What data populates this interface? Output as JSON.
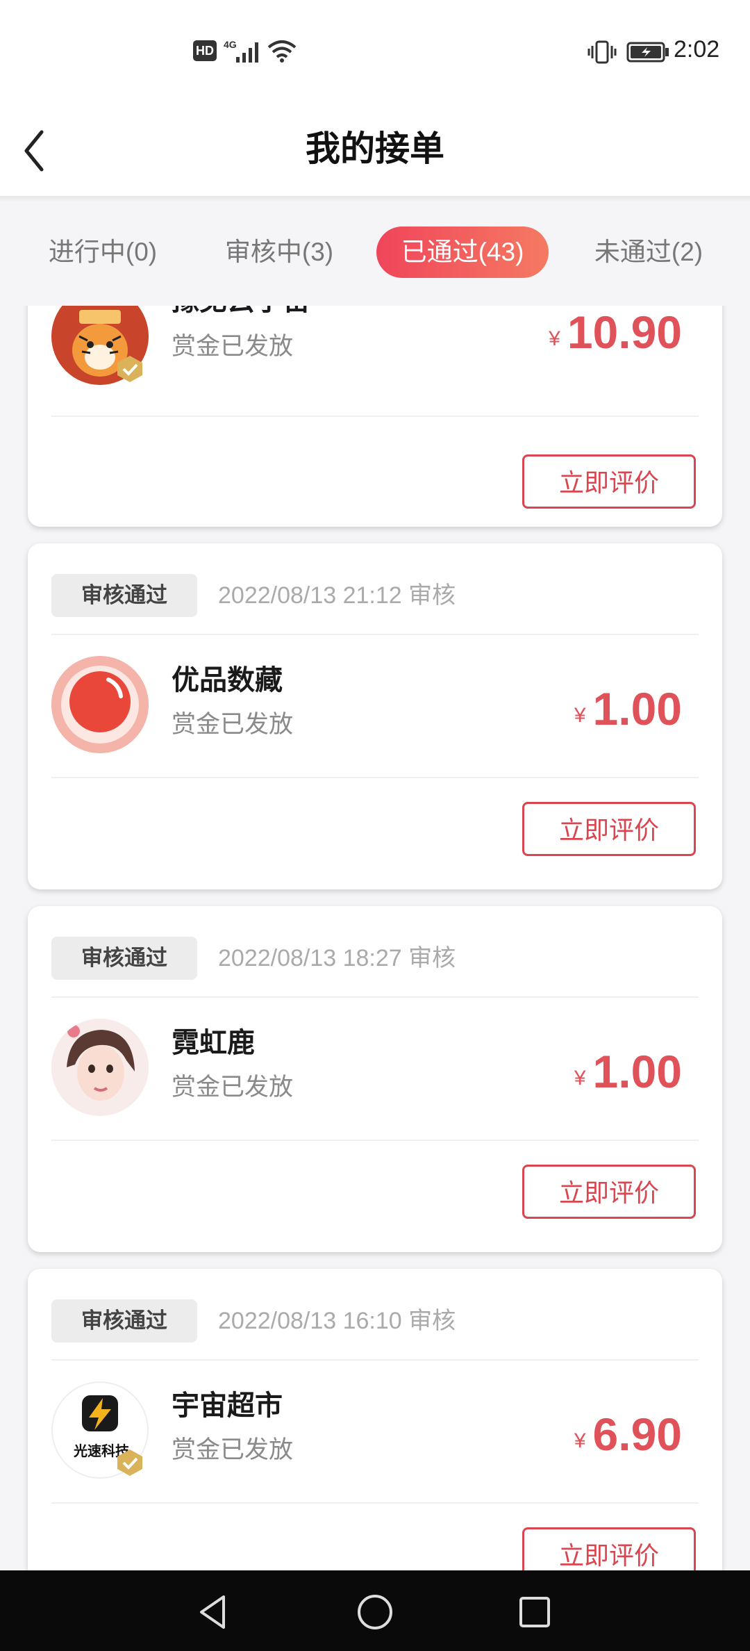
{
  "status_bar": {
    "hd": "HD",
    "network": "4G",
    "time": "2:02"
  },
  "header": {
    "title": "我的接单"
  },
  "tabs": [
    {
      "label": "进行中(0)"
    },
    {
      "label": "审核中(3)"
    },
    {
      "label": "已通过(43)",
      "active": true
    },
    {
      "label": "未通过(2)"
    }
  ],
  "cards": [
    {
      "name": "豫见云宇宙",
      "status": "赏金已发放",
      "currency": "¥",
      "price": "10.90",
      "button": "立即评价",
      "avatar": "tiger-avatar"
    },
    {
      "badge": "审核通过",
      "time": "2022/08/13 21:12 审核",
      "name": "优品数藏",
      "status": "赏金已发放",
      "currency": "¥",
      "price": "1.00",
      "button": "立即评价",
      "avatar": "red-circle-logo"
    },
    {
      "badge": "审核通过",
      "time": "2022/08/13 18:27 审核",
      "name": "霓虹鹿",
      "status": "赏金已发放",
      "currency": "¥",
      "price": "1.00",
      "button": "立即评价",
      "avatar": "girl-avatar"
    },
    {
      "badge": "审核通过",
      "time": "2022/08/13 16:10 审核",
      "name": "宇宙超市",
      "status": "赏金已发放",
      "currency": "¥",
      "price": "6.90",
      "button": "立即评价",
      "avatar": "lightning-logo",
      "avatar_text": "光速科技"
    }
  ],
  "colors": {
    "accent": "#e0525a",
    "tab_gradient_start": "#f0455a",
    "tab_gradient_end": "#f57a62"
  }
}
